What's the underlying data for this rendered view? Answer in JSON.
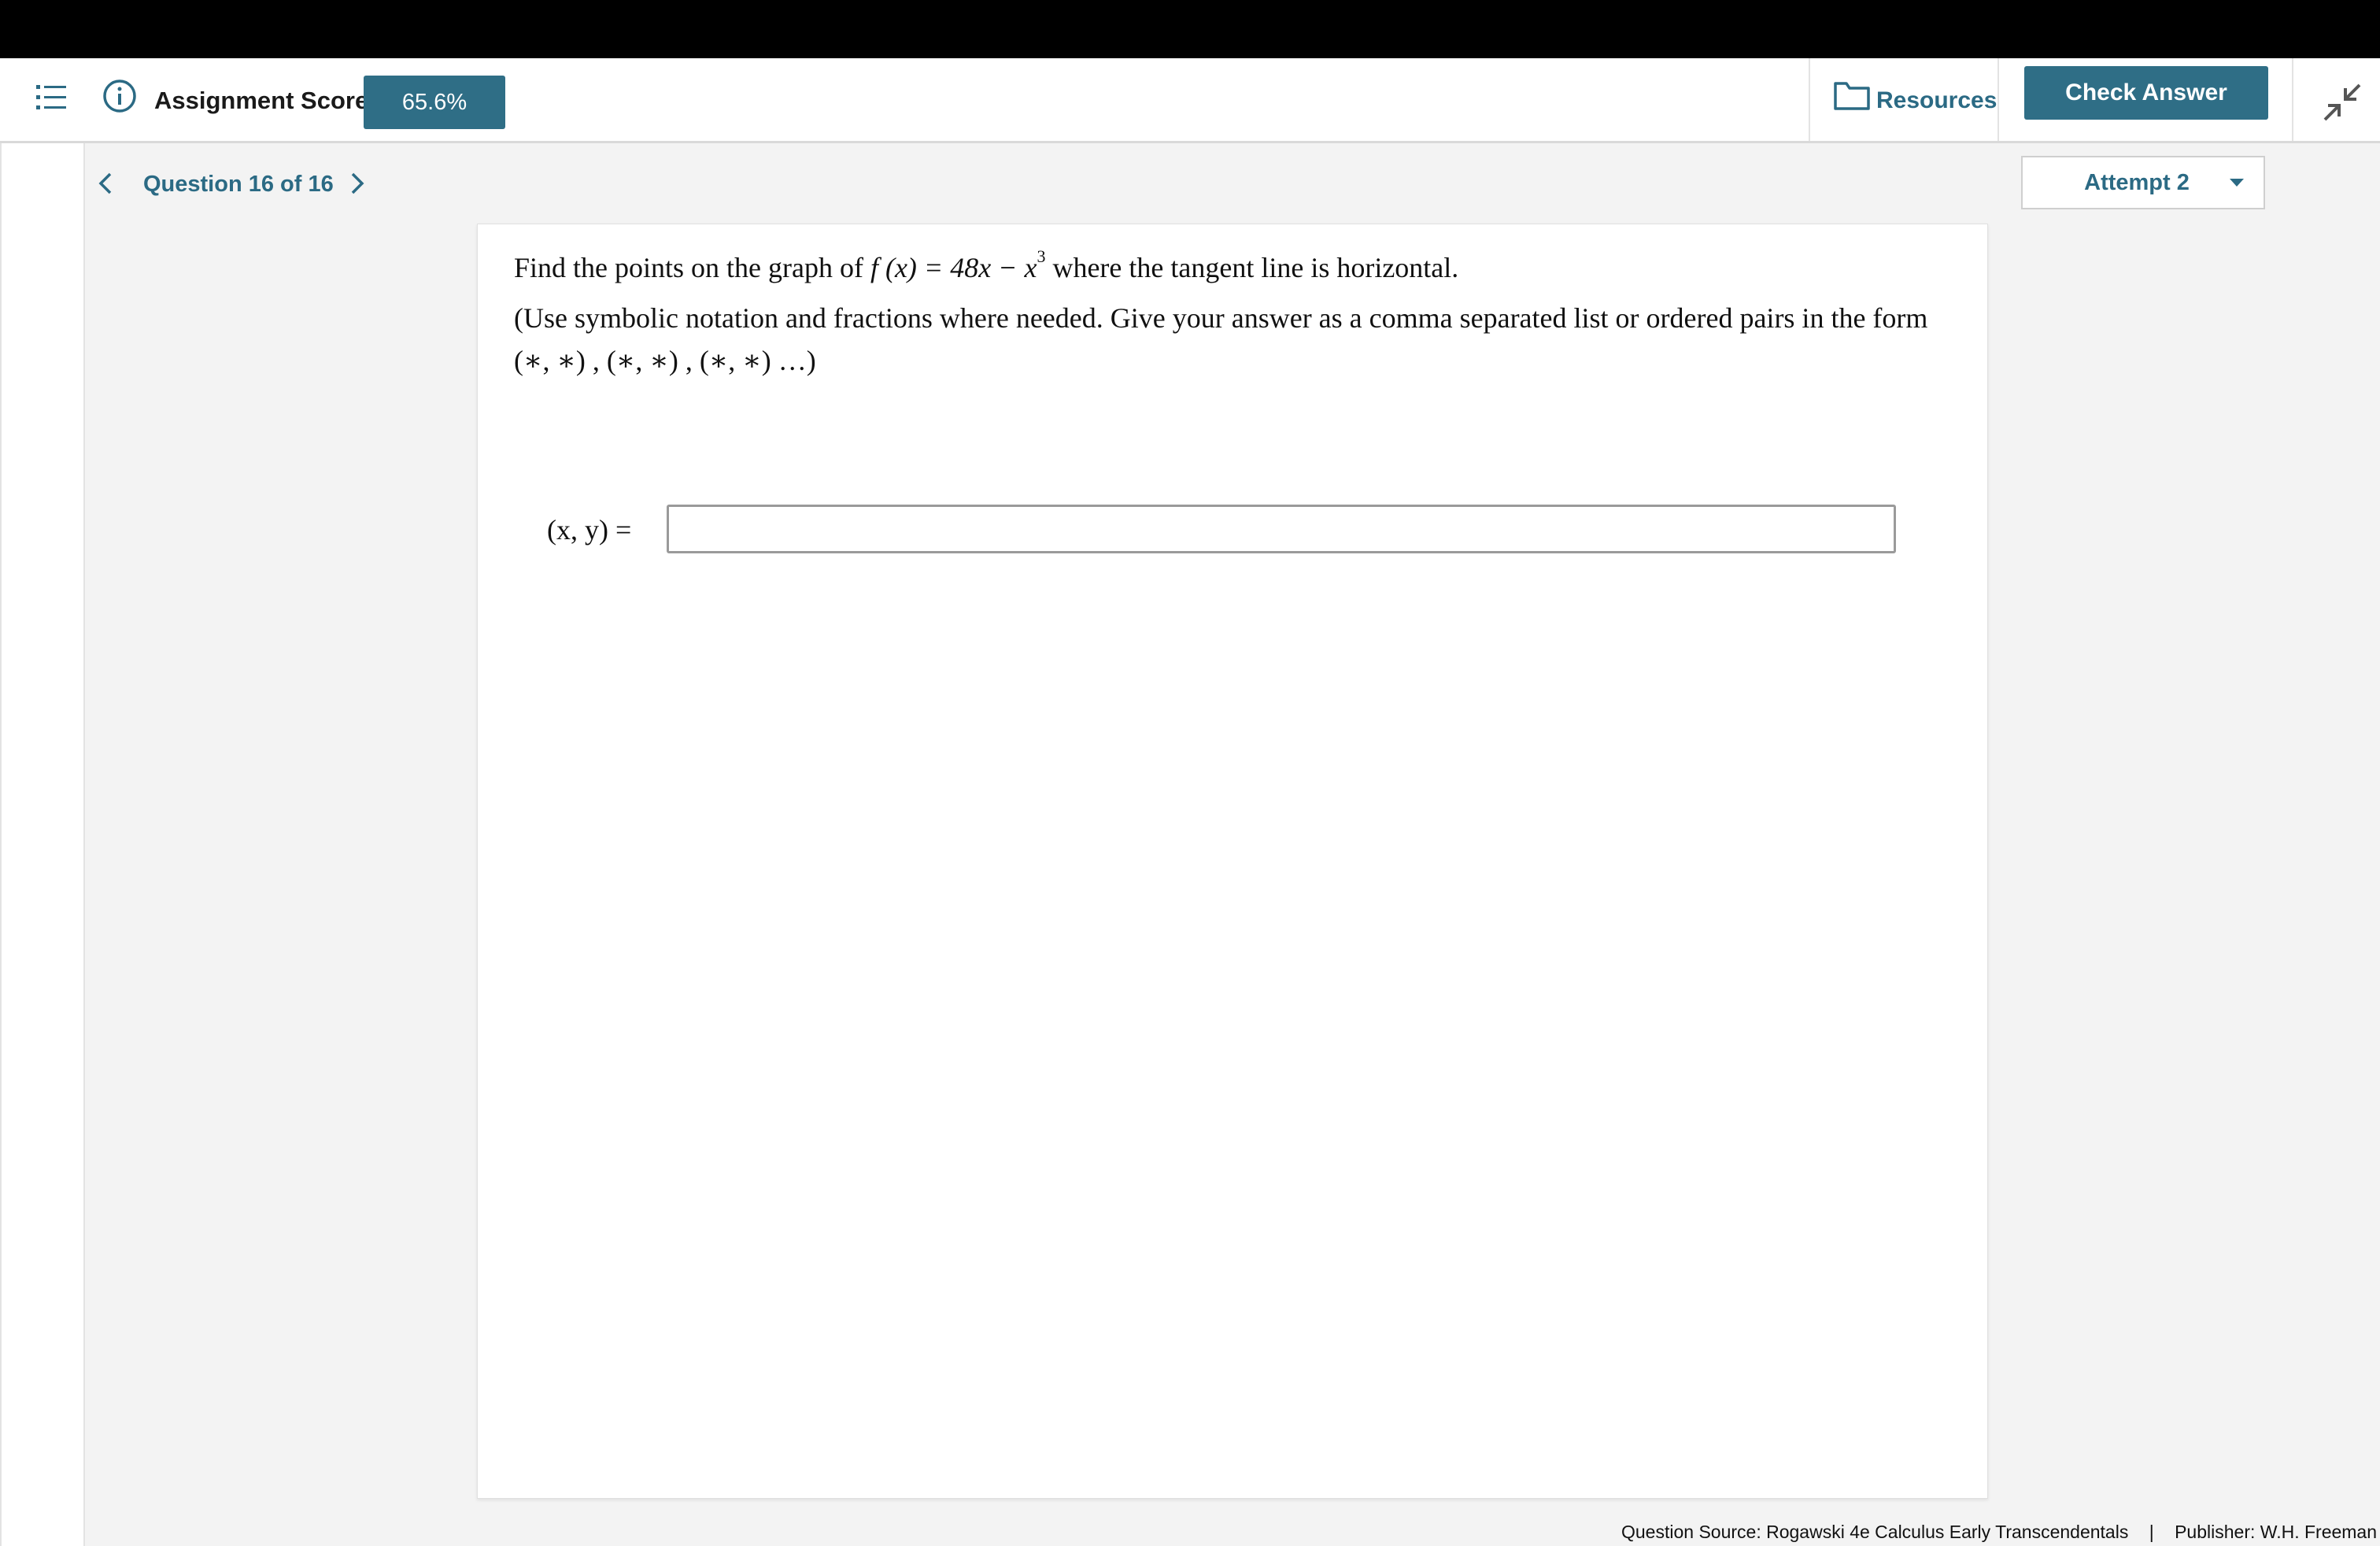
{
  "header": {
    "score_label": "Assignment Score:",
    "score_value": "65.6%",
    "resources_label": "Resources",
    "check_answer_label": "Check Answer",
    "icons": [
      "list-icon",
      "info-icon",
      "folder-icon",
      "collapse-icon"
    ]
  },
  "nav": {
    "question_label": "Question 16 of 16",
    "attempt_label": "Attempt 2"
  },
  "question": {
    "lead": "Find the points on the graph of",
    "func": "f (x) = 48x − x",
    "exponent": "3",
    "tail": "where the tangent line is horizontal.",
    "instructions": "(Use symbolic notation and fractions where needed. Give your answer as a comma separated list or ordered pairs in the form",
    "format": "(∗, ∗) , (∗, ∗) , (∗, ∗) …)",
    "answer_label": "(x, y) =",
    "answer_value": "",
    "answer_placeholder": ""
  },
  "footer": {
    "source": "Question Source: Rogawski 4e Calculus Early Transcendentals",
    "separator": "|",
    "publisher": "Publisher: W.H. Freeman"
  },
  "colors": {
    "accent": "#2f6e86",
    "link": "#2b6a84",
    "background": "#f3f3f3"
  }
}
